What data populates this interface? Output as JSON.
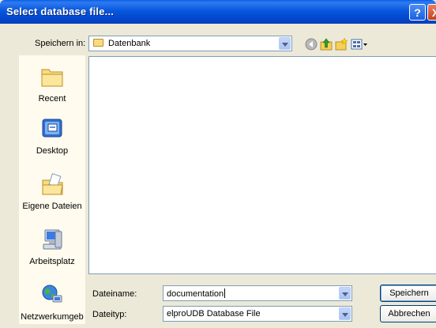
{
  "window": {
    "title": "Select database file..."
  },
  "titlebar": {
    "help": "?",
    "close": "X"
  },
  "toolbar": {
    "look_in_label": "Speichern in:",
    "look_in_value": "Datenbank"
  },
  "places": {
    "items": [
      {
        "label": "Recent",
        "icon": "recent-folder-icon"
      },
      {
        "label": "Desktop",
        "icon": "desktop-icon"
      },
      {
        "label": "Eigene Dateien",
        "icon": "my-documents-icon"
      },
      {
        "label": "Arbeitsplatz",
        "icon": "my-computer-icon"
      },
      {
        "label": "Netzwerkumgeb",
        "icon": "network-icon"
      }
    ]
  },
  "form": {
    "filename_label": "Dateiname:",
    "filename_value": "documentation",
    "filetype_label": "Dateityp:",
    "filetype_value": "elproUDB Database File"
  },
  "buttons": {
    "save": "Speichern",
    "cancel": "Abbrechen"
  }
}
